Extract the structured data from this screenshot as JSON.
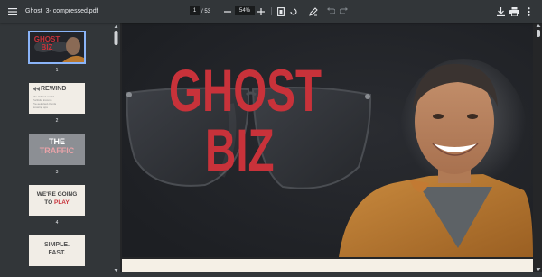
{
  "toolbar": {
    "file_name": "Ghost_3- compressed.pdf",
    "current_page": "1",
    "total_pages": "/ 53",
    "zoom": "54%"
  },
  "thumbnails": [
    {
      "number": "1",
      "title_line1": "GHOST",
      "title_line2": "BIZ"
    },
    {
      "number": "2",
      "title_line1": "REWIND",
      "lines": [
        "The 'Ghost' model",
        "Portfolio income",
        "Pre-selected clients",
        "Growing ops"
      ]
    },
    {
      "number": "3",
      "title_line1": "THE",
      "title_line2": "TRAFFIC"
    },
    {
      "number": "4",
      "title_line1": "WE'RE GOING",
      "title_line2_a": "TO ",
      "title_line2_b": "PLAY"
    },
    {
      "number": "5",
      "title_line1": "SIMPLE.",
      "title_line2": "FAST."
    }
  ],
  "slide": {
    "title_line1": "GHOST",
    "title_line2": "BIZ"
  },
  "colors": {
    "accent_red": "#c8323a",
    "toolbar_bg": "#323639",
    "selected_thumb_border": "#8ab4f8"
  },
  "icons": {
    "menu": "menu-icon",
    "zoom_out": "minus-icon",
    "zoom_in": "plus-icon",
    "fit": "fit-page-icon",
    "rotate": "rotate-icon",
    "annotate": "pen-icon",
    "undo": "undo-icon",
    "redo": "redo-icon",
    "download": "download-icon",
    "print": "print-icon",
    "more": "more-vert-icon"
  }
}
